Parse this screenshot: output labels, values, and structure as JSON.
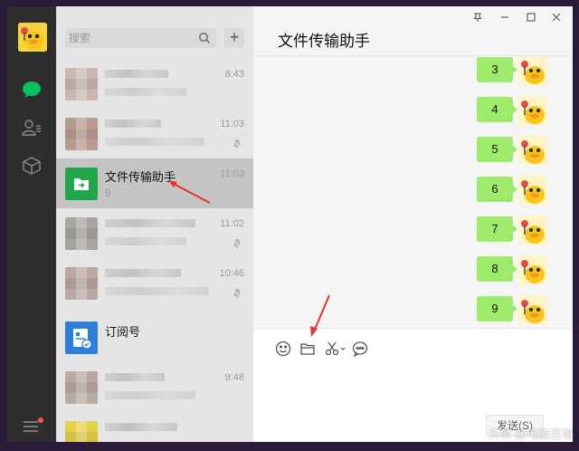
{
  "sidebar": {
    "icons": [
      "chat-icon",
      "contacts-icon",
      "favorites-icon",
      "menu-icon"
    ]
  },
  "search": {
    "placeholder": "搜索"
  },
  "add_button": "+",
  "conversations": [
    {
      "name": "",
      "preview": "",
      "time": "8:43",
      "muted": false,
      "selected": false
    },
    {
      "name": "",
      "preview": "",
      "time": "11:03",
      "muted": true,
      "selected": false
    },
    {
      "name": "文件传输助手",
      "preview": "9",
      "time": "11:03",
      "muted": false,
      "selected": true
    },
    {
      "name": "",
      "preview": "",
      "time": "11:02",
      "muted": true,
      "selected": false
    },
    {
      "name": "",
      "preview": "",
      "time": "10:46",
      "muted": true,
      "selected": false
    },
    {
      "name": "订阅号",
      "preview": "",
      "time": "",
      "muted": false,
      "selected": false
    },
    {
      "name": "",
      "preview": "",
      "time": "9:48",
      "muted": false,
      "selected": false
    },
    {
      "name": "",
      "preview": "",
      "time": "",
      "muted": false,
      "selected": false
    }
  ],
  "chat": {
    "title": "文件传输助手",
    "window_controls": [
      "pin-icon",
      "minimize-icon",
      "maximize-icon",
      "close-icon"
    ],
    "messages": [
      "3",
      "4",
      "5",
      "6",
      "7",
      "8",
      "9"
    ],
    "toolbar": [
      "emoji-icon",
      "folder-icon",
      "scissors-icon",
      "chat-bubble-icon"
    ],
    "send_label": "发送(S)"
  },
  "watermark": "头条 @电脑百事"
}
